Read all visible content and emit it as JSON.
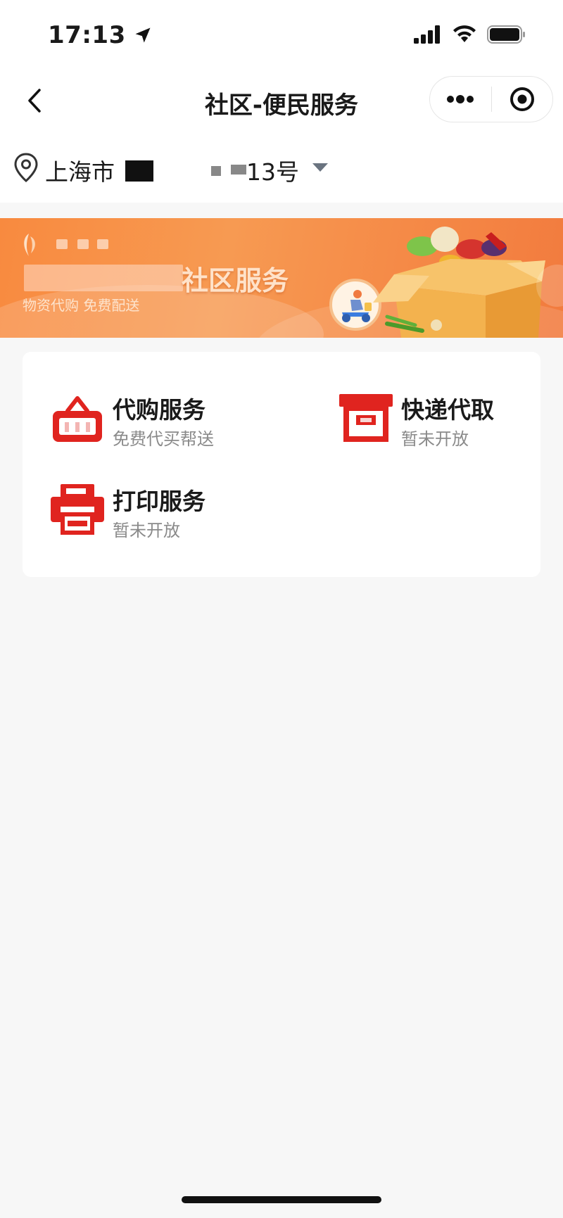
{
  "status_bar": {
    "time": "17:13",
    "icons": [
      "location-arrow-icon",
      "signal-icon",
      "wifi-icon",
      "battery-icon"
    ]
  },
  "nav": {
    "title": "社区-便民服务",
    "icons": [
      "back-icon",
      "more-icon",
      "close-target-icon"
    ]
  },
  "location": {
    "prefix": "上海市",
    "suffix": "13号",
    "icons": [
      "map-pin-icon",
      "caret-down-icon"
    ]
  },
  "banner": {
    "title": "社区服务",
    "subtitle_visible": "物资代购 免费配送"
  },
  "services": [
    {
      "id": "purchase",
      "title": "代购服务",
      "subtitle": "免费代买帮送",
      "icon": "basket-icon",
      "color": "#e0241f"
    },
    {
      "id": "express",
      "title": "快递代取",
      "subtitle": "暂未开放",
      "icon": "box-icon",
      "color": "#e0241f"
    },
    {
      "id": "print",
      "title": "打印服务",
      "subtitle": "暂未开放",
      "icon": "printer-icon",
      "color": "#e0241f"
    }
  ],
  "colors": {
    "accent_red": "#e0241f",
    "banner_orange": "#f79a52",
    "background": "#f7f7f7"
  }
}
